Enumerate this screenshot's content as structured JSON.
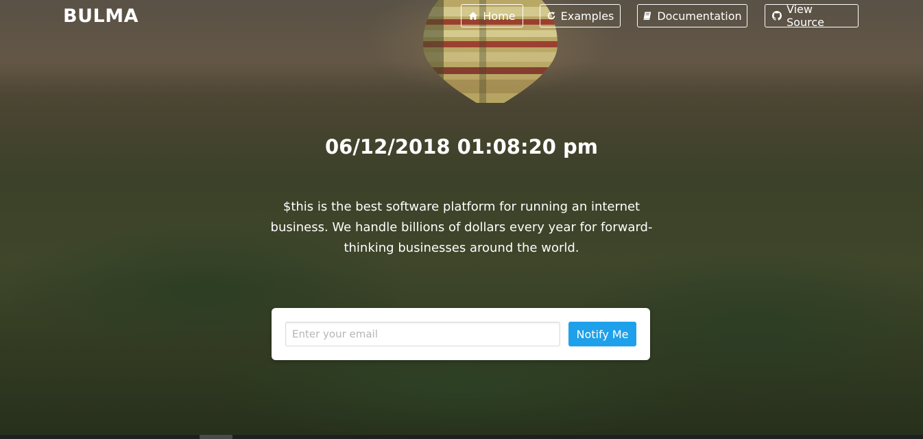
{
  "colors": {
    "accent": "#1fa0ea",
    "text_on_hero": "#ffffff",
    "card_bg": "#ffffff"
  },
  "navbar": {
    "brand": "BULMA",
    "items": [
      {
        "label": "Home",
        "icon": "home-icon"
      },
      {
        "label": "Examples",
        "icon": "refresh-icon"
      },
      {
        "label": "Documentation",
        "icon": "book-icon"
      },
      {
        "label": "View Source",
        "icon": "github-icon"
      }
    ]
  },
  "hero": {
    "datetime": "06/12/2018 01:08:20 pm",
    "subtitle": "$this is the best software platform for running an internet business. We handle billions of dollars every year for forward-thinking businesses around the world.",
    "background_image": "hot-air-balloon-over-palm-trees"
  },
  "signup": {
    "email_placeholder": "Enter your email",
    "email_value": "",
    "button_label": "Notify Me"
  }
}
